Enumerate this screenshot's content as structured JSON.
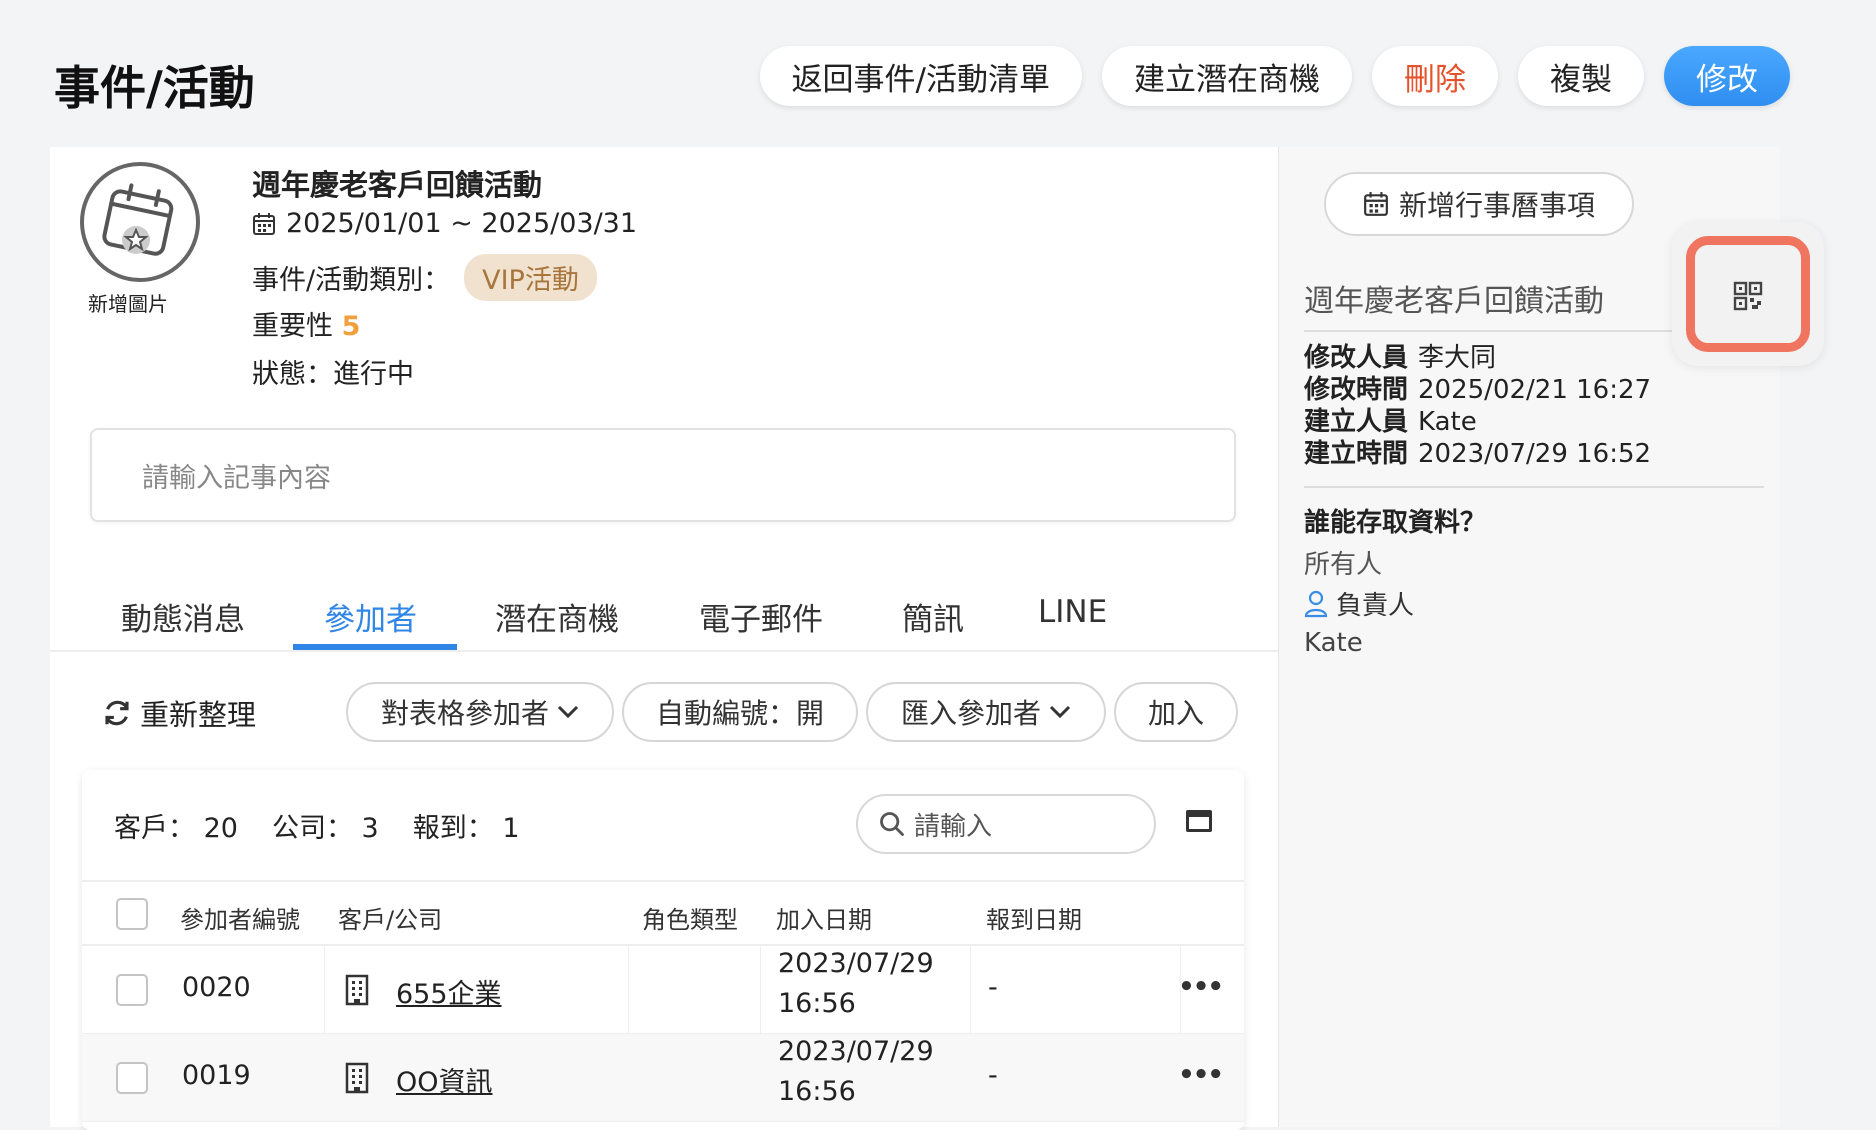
{
  "header": {
    "title": "事件/活動",
    "actions": {
      "back": "返回事件/活動清單",
      "create_opportunity": "建立潛在商機",
      "delete": "刪除",
      "copy": "複製",
      "edit": "修改"
    }
  },
  "event": {
    "avatar_caption": "新增圖片",
    "title": "週年慶老客戶回饋活動",
    "date_range": "2025/01/01 ~ 2025/03/31",
    "category_label": "事件/活動類別：",
    "category_value": "VIP活動",
    "importance_label": "重要性",
    "importance_value": "5",
    "status": "狀態：進行中",
    "note_placeholder": "請輸入記事內容"
  },
  "tabs": [
    {
      "label": "動態消息"
    },
    {
      "label": "參加者"
    },
    {
      "label": "潛在商機"
    },
    {
      "label": "電子郵件"
    },
    {
      "label": "簡訊"
    },
    {
      "label": "LINE"
    }
  ],
  "active_tab": "參加者",
  "toolbar": {
    "refresh": "重新整理",
    "to_sheet": "對表格參加者",
    "auto_number": "自動編號：開",
    "import": "匯入參加者",
    "add": "加入"
  },
  "summary": {
    "customers_label": "客戶：",
    "customers_value": "20",
    "companies_label": "公司：",
    "companies_value": "3",
    "checkin_label": "報到：",
    "checkin_value": "1",
    "search_placeholder": "請輸入"
  },
  "table": {
    "columns": [
      "參加者編號",
      "客戶/公司",
      "角色類型",
      "加入日期",
      "報到日期"
    ],
    "rows": [
      {
        "id": "0020",
        "company": "655企業",
        "role": "",
        "join_date": "2023/07/29",
        "join_time": "16:56",
        "checkin": "-"
      },
      {
        "id": "0019",
        "company": "OO資訊",
        "role": "",
        "join_date": "2023/07/29",
        "join_time": "16:56",
        "checkin": "-"
      }
    ]
  },
  "side": {
    "calendar_button": "新增行事曆事項",
    "title": "週年慶老客戶回饋活動",
    "meta": [
      {
        "label": "修改人員",
        "value": "李大同"
      },
      {
        "label": "修改時間",
        "value": "2025/02/21 16:27"
      },
      {
        "label": "建立人員",
        "value": "Kate"
      },
      {
        "label": "建立時間",
        "value": "2023/07/29 16:52"
      }
    ],
    "access_title": "誰能存取資料？",
    "access_all": "所有人",
    "access_owner": "負責人",
    "access_name": "Kate"
  },
  "colors": {
    "accent": "#2f86e6",
    "danger": "#e5532c",
    "badge_bg": "#f0e2cf",
    "badge_text": "#a8763c",
    "importance": "#f0a03c",
    "highlight": "#f07560"
  }
}
